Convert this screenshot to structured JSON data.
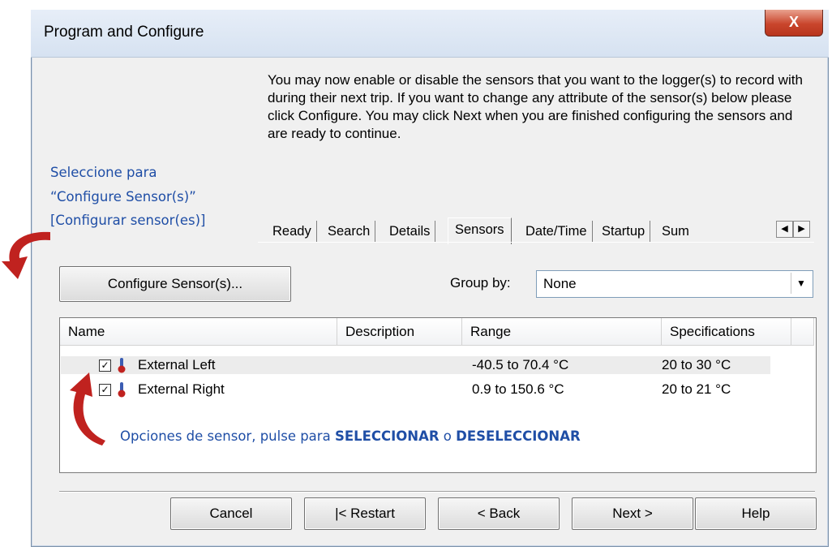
{
  "window": {
    "title": "Program and Configure",
    "close_symbol": "X"
  },
  "intro_text": "You may now enable or disable the sensors that you want to the logger(s) to record with during their next trip. If you want to change any attribute of the sensor(s) below please click Configure. You may click Next when you are finished configuring the sensors and are ready to continue.",
  "annotations": {
    "select_line1": "Seleccione para",
    "select_line2": "“Configure Sensor(s)”",
    "select_line3": "[Configurar sensor(es)]",
    "options_prefix": "Opciones de sensor, pulse para ",
    "options_select": "SELECCIONAR",
    "options_or": " o ",
    "options_deselect": "DESELECCIONAR",
    "arrow_color": "#c0221f",
    "text_color": "#1f4ea6"
  },
  "tabs": [
    "Ready",
    "Search",
    "Details",
    "Sensors",
    "Date/Time",
    "Startup",
    "Sum"
  ],
  "active_tab": "Sensors",
  "configure_button": {
    "label": "Configure Sensor(s)..."
  },
  "group_by": {
    "label": "Group by:",
    "value": "None"
  },
  "table": {
    "columns": [
      "Name",
      "Description",
      "Range",
      "Specifications"
    ],
    "rows": [
      {
        "checked": true,
        "name": "External Left",
        "description": "",
        "range": "-40.5 to 70.4 °C",
        "specifications": "20 to 30 °C"
      },
      {
        "checked": true,
        "name": "External Right",
        "description": "",
        "range": "0.9 to 150.6 °C",
        "specifications": "20 to 21 °C"
      }
    ]
  },
  "footer": {
    "cancel": "Cancel",
    "restart": "|< Restart",
    "back": "< Back",
    "next": "Next >",
    "help": "Help"
  }
}
